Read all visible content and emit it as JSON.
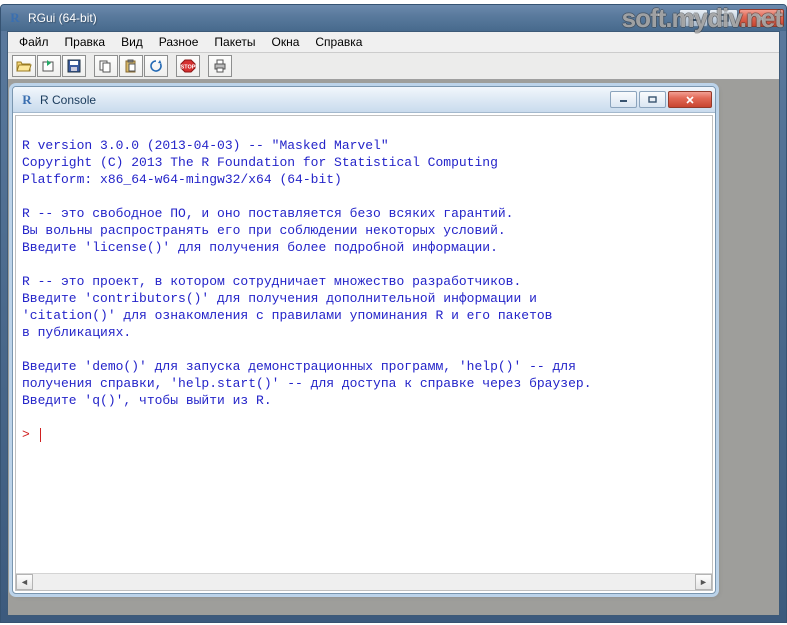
{
  "outer": {
    "title": "RGui (64-bit)"
  },
  "watermark": "soft.mydiv.net",
  "menu": {
    "items": [
      "Файл",
      "Правка",
      "Вид",
      "Разное",
      "Пакеты",
      "Окна",
      "Справка"
    ]
  },
  "toolbar": {
    "icons": [
      "open-icon",
      "load-workspace-icon",
      "save-icon",
      "sep",
      "copy-icon",
      "paste-icon",
      "refresh-icon",
      "sep",
      "stop-icon",
      "sep",
      "print-icon"
    ]
  },
  "console": {
    "title": "R Console",
    "lines": [
      "",
      "R version 3.0.0 (2013-04-03) -- \"Masked Marvel\"",
      "Copyright (C) 2013 The R Foundation for Statistical Computing",
      "Platform: x86_64-w64-mingw32/x64 (64-bit)",
      "",
      "R -- это свободное ПО, и оно поставляется безо всяких гарантий.",
      "Вы вольны распространять его при соблюдении некоторых условий.",
      "Введите 'license()' для получения более подробной информации.",
      "",
      "R -- это проект, в котором сотрудничает множество разработчиков.",
      "Введите 'contributors()' для получения дополнительной информации и",
      "'citation()' для ознакомления с правилами упоминания R и его пакетов",
      "в публикациях.",
      "",
      "Введите 'demo()' для запуска демонстрационных программ, 'help()' -- для",
      "получения справки, 'help.start()' -- для доступа к справке через браузер.",
      "Введите 'q()', чтобы выйти из R.",
      ""
    ],
    "prompt": "> "
  }
}
